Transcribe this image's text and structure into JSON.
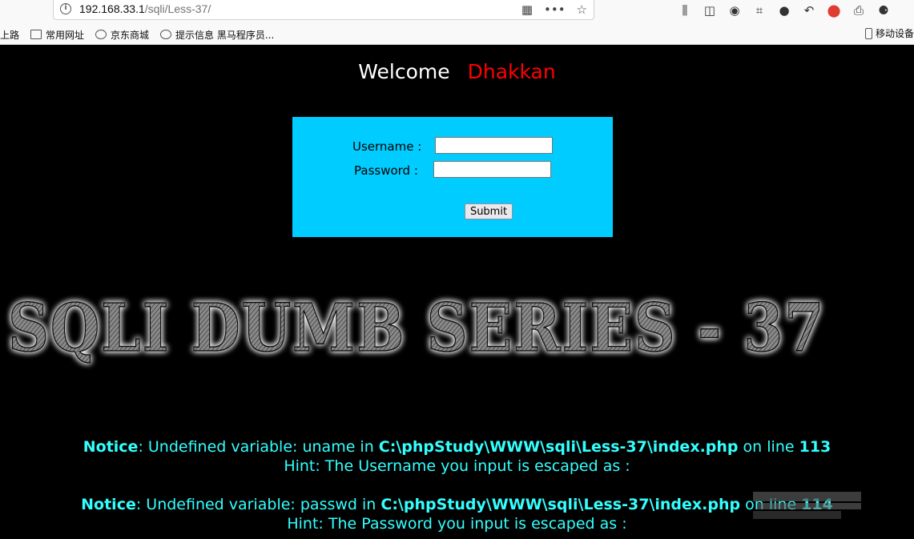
{
  "browser": {
    "url_host": "192.168.33.1",
    "url_path": "/sqli/Less-37/",
    "url_icons": [
      "qr-code-icon",
      "more-dots-icon",
      "star-icon"
    ],
    "toolbar_icons": [
      "library-icon",
      "sidebar-icon",
      "account-icon",
      "crop-icon",
      "chat-icon",
      "undo-icon",
      "location-icon",
      "print-icon",
      "extensions-icon"
    ],
    "bookmarks": [
      {
        "label": "上路",
        "icon": "none"
      },
      {
        "label": "常用网址",
        "icon": "folder-icon"
      },
      {
        "label": "京东商城",
        "icon": "globe-icon"
      },
      {
        "label": "提示信息 黑马程序员...",
        "icon": "refresh-globe-icon"
      }
    ],
    "mobile_bookmarks": "移动设备"
  },
  "page": {
    "welcome_label": "Welcome",
    "welcome_name": "Dhakkan",
    "welcome_name_color": "#ff0000",
    "form_bg_color": "#00ccff",
    "username_label": "Username :",
    "password_label": "Password :",
    "username_value": "",
    "password_value": "",
    "submit_label": "Submit",
    "banner_text": "SQLI DUMB SERIES - 37",
    "notices": [
      {
        "prefix": "Notice",
        "message": ": Undefined variable: uname in ",
        "path": "C:\\phpStudy\\WWW\\sqli\\Less-37\\index.php",
        "line_label": " on line ",
        "line": "113",
        "hint": "Hint: The Username you input is escaped as :"
      },
      {
        "prefix": "Notice",
        "message": ": Undefined variable: passwd in ",
        "path": "C:\\phpStudy\\WWW\\sqli\\Less-37\\index.php",
        "line_label": " on line ",
        "line": "114",
        "hint": "Hint: The Password you input is escaped as :"
      }
    ],
    "notice_color": "#33ffff"
  }
}
